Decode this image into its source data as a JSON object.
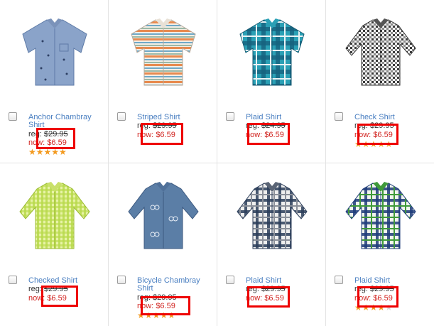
{
  "products": [
    {
      "name_line1": "Anchor Chambray",
      "name_line2": "Shirt",
      "reg_label": "reg:",
      "reg_price": "$29.95",
      "now_label": "now:",
      "now_price": "$6.59",
      "stars": "★★★★★",
      "stars_dim": "",
      "rating_of_5": 5
    },
    {
      "name_line1": "Striped Shirt",
      "name_line2": "",
      "reg_label": "reg:",
      "reg_price": "$29.95",
      "now_label": "now:",
      "now_price": "$6.59",
      "stars": "",
      "stars_dim": ""
    },
    {
      "name_line1": "Plaid Shirt",
      "name_line2": "",
      "reg_label": "reg:",
      "reg_price": "$24.95",
      "now_label": "now:",
      "now_price": "$6.59",
      "stars": "",
      "stars_dim": ""
    },
    {
      "name_line1": "Check Shirt",
      "name_line2": "",
      "reg_label": "reg:",
      "reg_price": "$29.95",
      "now_label": "now:",
      "now_price": "$6.59",
      "stars": "★★★★★",
      "stars_dim": "",
      "rating_of_5": 5
    },
    {
      "name_line1": "Checked Shirt",
      "name_line2": "",
      "reg_label": "reg:",
      "reg_price": "$29.95",
      "now_label": "now:",
      "now_price": "$6.59",
      "stars": "",
      "stars_dim": ""
    },
    {
      "name_line1": "Bicycle Chambray",
      "name_line2": "Shirt",
      "reg_label": "reg:",
      "reg_price": "$29.95",
      "now_label": "now:",
      "now_price": "$6.59",
      "stars": "★★★★★",
      "stars_dim": "",
      "rating_of_5": 5
    },
    {
      "name_line1": "Plaid Shirt",
      "name_line2": "",
      "reg_label": "reg:",
      "reg_price": "$29.95",
      "now_label": "now:",
      "now_price": "$6.59",
      "stars": "",
      "stars_dim": ""
    },
    {
      "name_line1": "Plaid Shirt",
      "name_line2": "",
      "reg_label": "reg:",
      "reg_price": "$29.95",
      "now_label": "now:",
      "now_price": "$6.59",
      "stars": "★★★★",
      "stars_dim": "★",
      "rating_of_5": 4.5
    }
  ],
  "colors": {
    "link": "#4a7fc1",
    "sale": "#d1231f",
    "star": "#f39a1f",
    "highlight_box": "#ee0000"
  }
}
